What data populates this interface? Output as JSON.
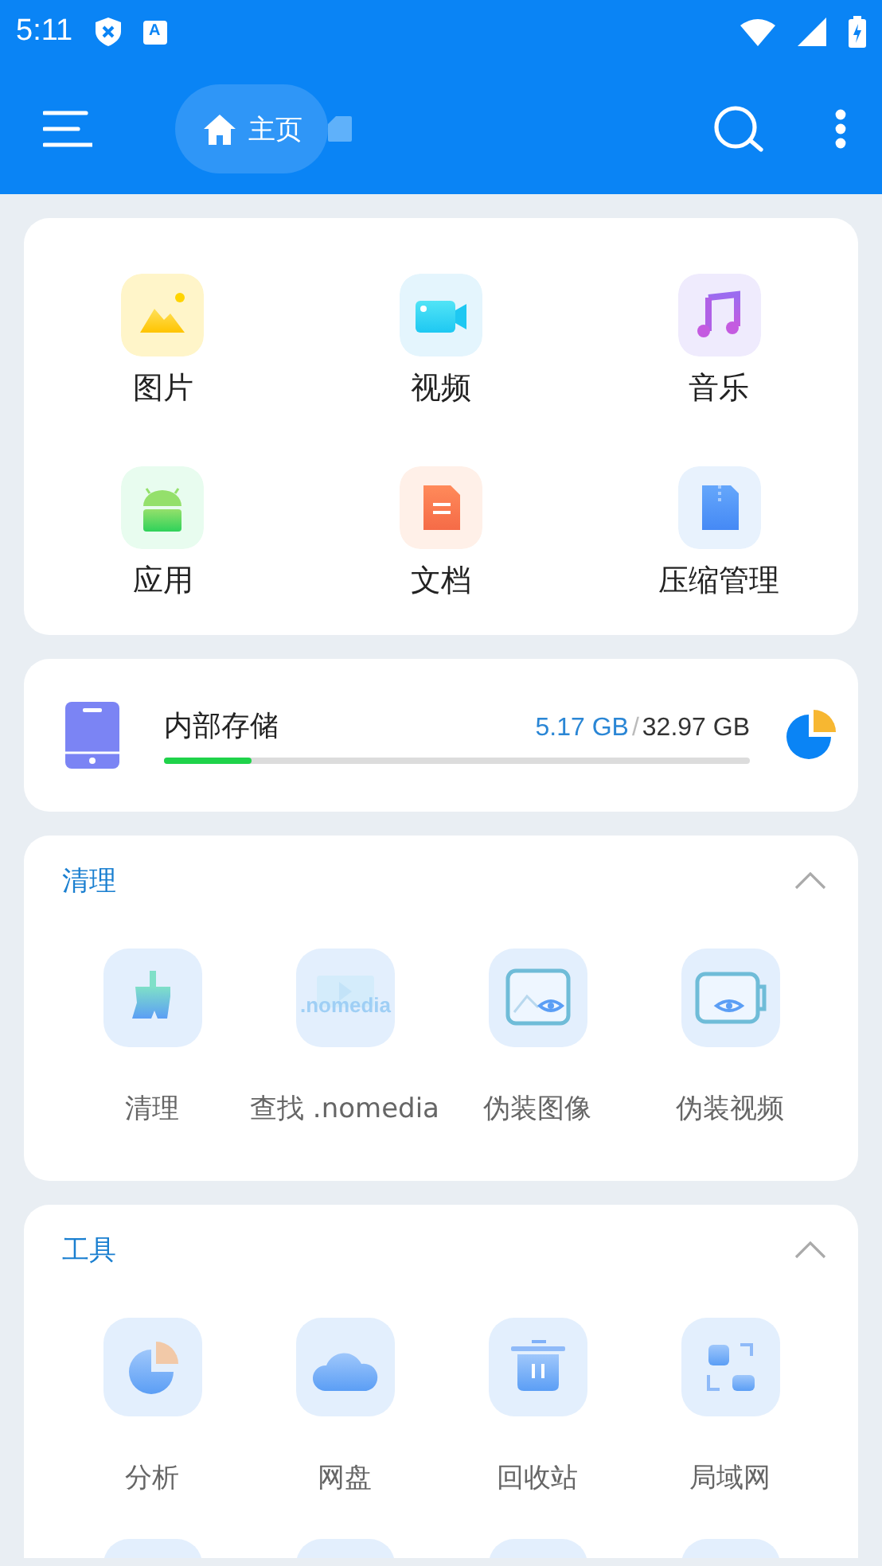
{
  "status_bar": {
    "time": "5:11",
    "badge_letter": "A"
  },
  "app_bar": {
    "breadcrumbs": [
      {
        "label": "主页",
        "selected": true
      }
    ]
  },
  "categories": [
    {
      "label": "图片"
    },
    {
      "label": "视频"
    },
    {
      "label": "音乐"
    },
    {
      "label": "应用"
    },
    {
      "label": "文档"
    },
    {
      "label": "压缩管理"
    }
  ],
  "storage": {
    "name": "内部存储",
    "used": "5.17 GB",
    "separator": "/",
    "total": "32.97 GB",
    "level": 0.15
  },
  "sections": [
    {
      "title": "清理",
      "expanded": true,
      "items": [
        {
          "label": "清理"
        },
        {
          "label": "查找 .nomedia",
          "icon_text": ".nomedia"
        },
        {
          "label": "伪装图像"
        },
        {
          "label": "伪装视频"
        }
      ]
    },
    {
      "title": "工具",
      "expanded": true,
      "items": [
        {
          "label": "分析"
        },
        {
          "label": "网盘"
        },
        {
          "label": "回收站"
        },
        {
          "label": "局域网"
        }
      ]
    }
  ]
}
